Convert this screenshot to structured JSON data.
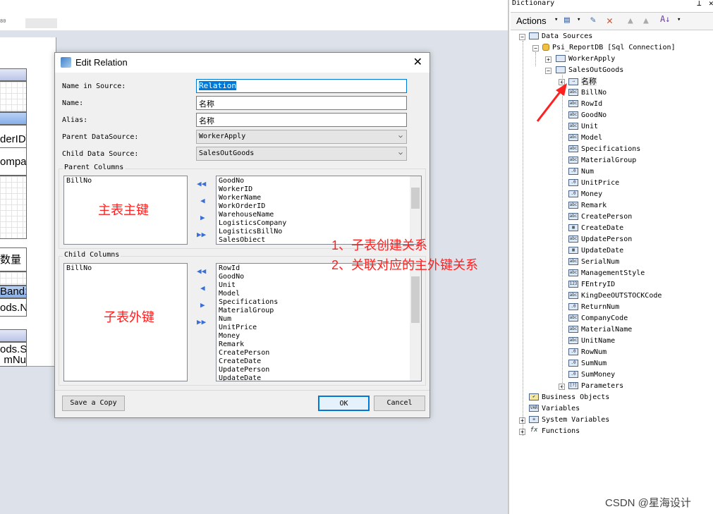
{
  "designer": {
    "ruler_text": "80",
    "band_texts": [
      "derID]",
      "ompa",
      "数量",
      "Band1",
      "ods.N",
      "ods.S",
      "mNu"
    ]
  },
  "dialog": {
    "title": "Edit Relation",
    "close_icon": "close-icon",
    "name_in_source_label": "Name in Source:",
    "name_in_source": "Relation",
    "name_label": "Name:",
    "name": "名称",
    "alias_label": "Alias:",
    "alias": "名称",
    "parent_ds_label": "Parent DataSource:",
    "parent_ds": "WorkerApply",
    "child_ds_label": "Child Data Source:",
    "child_ds": "SalesOutGoods",
    "parent_columns_label": "Parent Columns",
    "parent_selected": [
      "BillNo"
    ],
    "parent_available": [
      "GoodNo",
      "WorkerID",
      "WorkerName",
      "WorkOrderID",
      "WarehouseName",
      "LogisticsCompany",
      "LogisticsBillNo",
      "SalesObiect"
    ],
    "child_columns_label": "Child Columns",
    "child_selected": [
      "BillNo"
    ],
    "child_available": [
      "RowId",
      "GoodNo",
      "Unit",
      "Model",
      "Specifications",
      "MaterialGroup",
      "Num",
      "UnitPrice",
      "Money",
      "Remark",
      "CreatePerson",
      "CreateDate",
      "UpdatePerson",
      "UpdateDate"
    ],
    "save_copy": "Save a Copy",
    "ok": "OK",
    "cancel": "Cancel"
  },
  "annotations": {
    "parent_key": "主表主键",
    "child_key": "子表外键",
    "step1": "1、子表创建关系",
    "step2": "2、关联对应的主外键关系",
    "color": "#ff2020"
  },
  "dictionary": {
    "title": "Dictionary",
    "actions": "Actions",
    "tree": {
      "data_sources": "Data Sources",
      "connection": "Psi_ReportDB [Sql Connection]",
      "tables": [
        "WorkerApply",
        "SalesOutGoods"
      ],
      "relation": "名称",
      "fields": [
        {
          "name": "BillNo",
          "type": "abc"
        },
        {
          "name": "RowId",
          "type": "abc"
        },
        {
          "name": "GoodNo",
          "type": "abc"
        },
        {
          "name": "Unit",
          "type": "abc"
        },
        {
          "name": "Model",
          "type": "abc"
        },
        {
          "name": "Specifications",
          "type": "abc"
        },
        {
          "name": "MaterialGroup",
          "type": "abc"
        },
        {
          "name": "Num",
          "type": ".0"
        },
        {
          "name": "UnitPrice",
          "type": ".0"
        },
        {
          "name": "Money",
          "type": ".0"
        },
        {
          "name": "Remark",
          "type": "abc"
        },
        {
          "name": "CreatePerson",
          "type": "abc"
        },
        {
          "name": "CreateDate",
          "type": "date"
        },
        {
          "name": "UpdatePerson",
          "type": "abc"
        },
        {
          "name": "UpdateDate",
          "type": "date"
        },
        {
          "name": "SerialNum",
          "type": "abc"
        },
        {
          "name": "ManagementStyle",
          "type": "abc"
        },
        {
          "name": "FEntryID",
          "type": "123"
        },
        {
          "name": "KingDeeOUTSTOCKCode",
          "type": "abc"
        },
        {
          "name": "ReturnNum",
          "type": ".0"
        },
        {
          "name": "CompanyCode",
          "type": "abc"
        },
        {
          "name": "MaterialName",
          "type": "abc"
        },
        {
          "name": "UnitName",
          "type": "abc"
        },
        {
          "name": "RowNum",
          "type": ".0"
        },
        {
          "name": "SumNum",
          "type": ".0"
        },
        {
          "name": "SumMoney",
          "type": ".0"
        }
      ],
      "parameters": "Parameters",
      "business_objects": "Business Objects",
      "variables": "Variables",
      "system_variables": "System Variables",
      "functions": "Functions"
    }
  },
  "watermark": "CSDN @星海设计"
}
